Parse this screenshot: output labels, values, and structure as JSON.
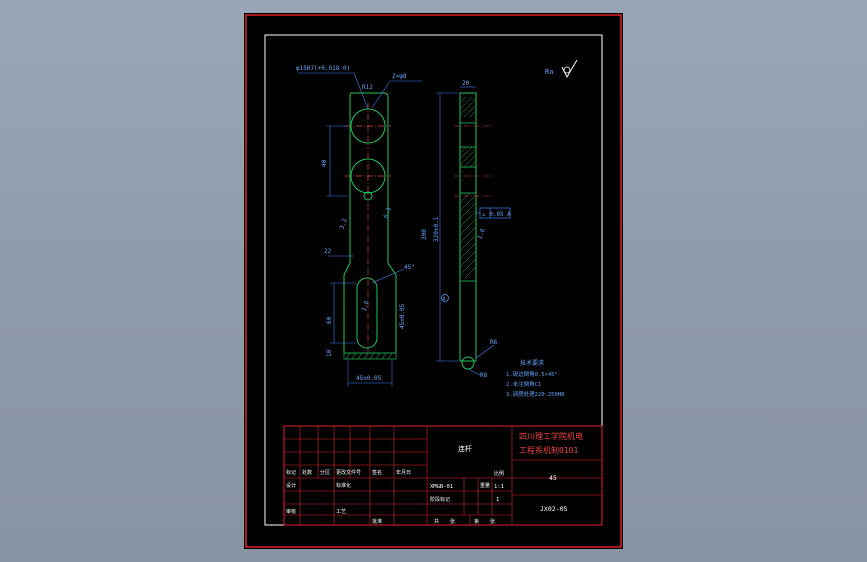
{
  "colors": {
    "background": "#8e99a9",
    "sheet": "#000000",
    "outer_frame": "#e0202a",
    "inner_frame": "#ffffff",
    "part_outline": "#22c55e",
    "dimension": "#3b82f6",
    "centerline": "#ef4444",
    "hatch": "#16a34a",
    "title_block_grid": "#e0202a",
    "title_text": "#ef4444",
    "label_text": "#60a5fa"
  },
  "drawing": {
    "roughness_symbol": "Ra",
    "dims": {
      "hole_tol": "φ15H7(+0.018 0)",
      "two_holes": "2×φ8",
      "spacing": "40",
      "r12": "R12",
      "overall": "320±0.1",
      "length": "300",
      "slot_len": "60",
      "bottom": "10",
      "width_bottom": "45±0.05",
      "slot_w": "R6",
      "taper": "22",
      "angle": "45°",
      "thickness": "20",
      "r6": "R6",
      "r8": "R8",
      "gdt_box": "⊥ 0.05 A",
      "datum": "A",
      "ra_left": "3.2",
      "ra_mid": "6.3",
      "ra_right": "1.6"
    },
    "notes": {
      "title": "技术要求",
      "lines": [
        "1.锐边倒角0.5×45°",
        "2.未注倒角C1",
        "3.调质处理220-250HB"
      ]
    }
  },
  "title_block": {
    "school_line1": "四川理工学院机电",
    "school_line2": "工程系机制0101",
    "part_name": "连杆",
    "drawing_no": "XMGB-01",
    "material": "45",
    "scale": "1:1",
    "sheet_no": "1",
    "weight": "",
    "code": "JX02-05",
    "small_row_labels": [
      "标记",
      "处数",
      "分区",
      "更改文件号",
      "签名",
      "年月日"
    ],
    "row2_labels": [
      "设计",
      "标准化",
      "阶段标记",
      "重量",
      "比例"
    ],
    "row3_labels": [
      "审核",
      "工艺",
      "批准"
    ],
    "sheet_labels": [
      "共",
      "张",
      "第",
      "张"
    ]
  }
}
